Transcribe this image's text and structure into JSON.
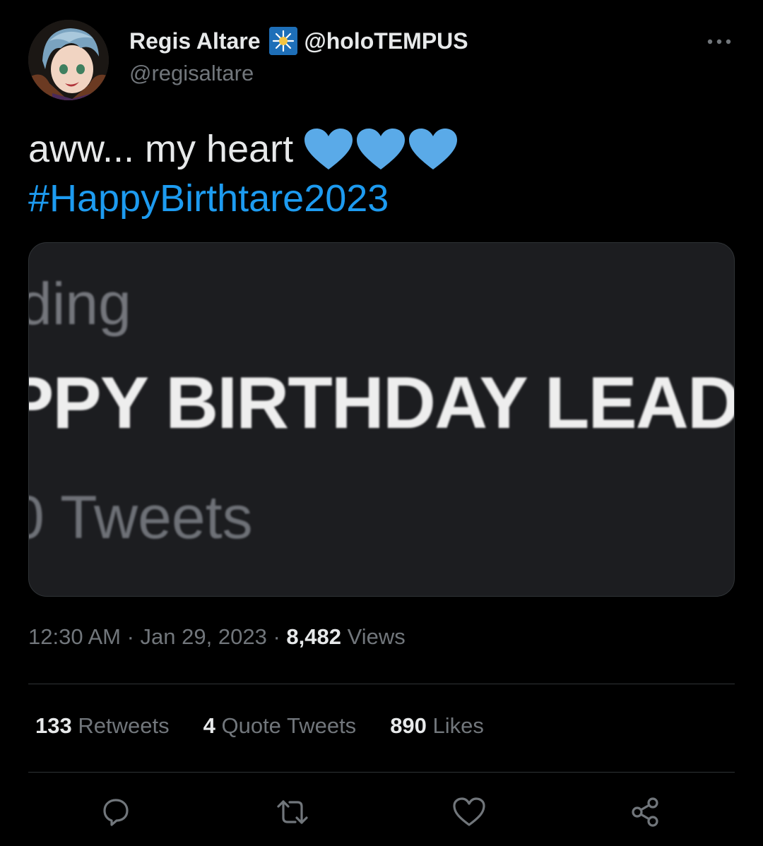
{
  "author": {
    "display_name": "Regis Altare",
    "affiliation_handle": "@holoTEMPUS",
    "affiliation_badge_icon": "tempus-badge-icon",
    "handle": "@regisaltare"
  },
  "tweet": {
    "text": "aww... my heart",
    "emoji": [
      "blue-heart-icon",
      "blue-heart-icon",
      "blue-heart-icon"
    ],
    "hashtag": "#HappyBirthtare2023"
  },
  "media": {
    "line1": "ding",
    "line2": "PPY BIRTHDAY LEAD",
    "line3": "0 Tweets"
  },
  "meta": {
    "time": "12:30 AM",
    "separator": "·",
    "date": "Jan 29, 2023",
    "views_count": "8,482",
    "views_label": "Views"
  },
  "stats": {
    "retweets_count": "133",
    "retweets_label": "Retweets",
    "quotes_count": "4",
    "quotes_label": "Quote Tweets",
    "likes_count": "890",
    "likes_label": "Likes"
  },
  "actions": [
    "reply-icon",
    "retweet-icon",
    "like-icon",
    "share-icon"
  ],
  "colors": {
    "background": "#000000",
    "primary_text": "#e7e9ea",
    "secondary_text": "#71767b",
    "link": "#1d9bf0",
    "divider": "#2f3336",
    "heart": "#5aaae8"
  }
}
